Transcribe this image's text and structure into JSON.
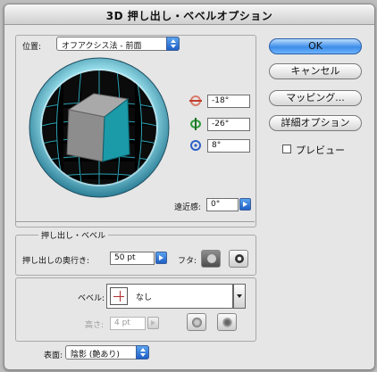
{
  "window": {
    "title": "3D 押し出し・ベベルオプション"
  },
  "position": {
    "label": "位置:",
    "preset": "オフアクシス法 - 前面",
    "rotation_x": "-18°",
    "rotation_y": "-26°",
    "rotation_z": "8°",
    "perspective_label": "遠近感:",
    "perspective_value": "0°"
  },
  "buttons": {
    "ok": "OK",
    "cancel": "キャンセル",
    "mapping": "マッピング...",
    "more_options": "詳細オプション",
    "preview": "プレビュー"
  },
  "extrude": {
    "group_label": "押し出し・ベベル",
    "depth_label": "押し出しの奥行き:",
    "depth_value": "50 pt",
    "cap_label": "フタ:",
    "bevel_label": "ベベル:",
    "bevel_value": "なし",
    "height_label": "高さ:",
    "height_value": "4 pt"
  },
  "surface": {
    "label": "表面:",
    "value": "陰影 (艶あり)"
  },
  "colors": {
    "cube_front": "#1b9aa8",
    "cube_top": "#a9a9a9",
    "cube_side": "#8d8d8d",
    "grid": "#2fb3c6"
  }
}
